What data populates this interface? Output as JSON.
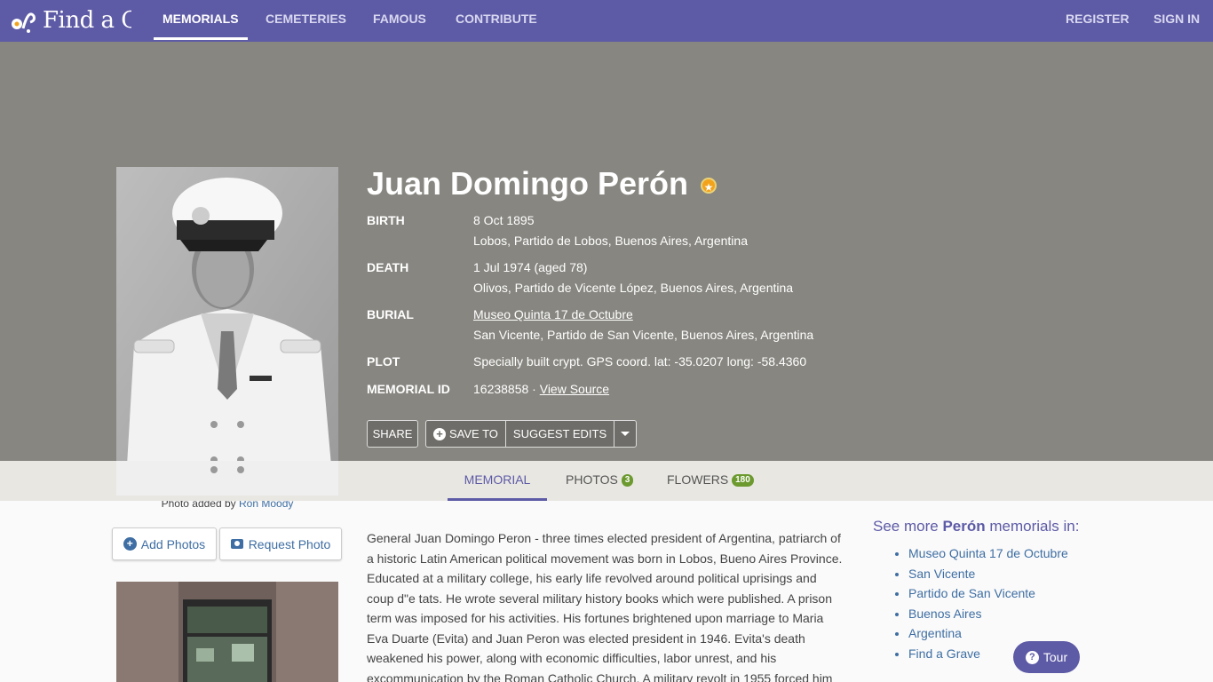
{
  "header": {
    "logo_text": "Find a Grave",
    "nav": [
      "MEMORIALS",
      "CEMETERIES",
      "FAMOUS",
      "CONTRIBUTE"
    ],
    "register": "REGISTER",
    "sign_in": "SIGN IN"
  },
  "memorial": {
    "name": "Juan Domingo Perón",
    "famous_badge_icon": "star-icon",
    "photo_caption_prefix": "Photo added by",
    "photo_added_by": "Ron Moody",
    "facts": {
      "birth_label": "BIRTH",
      "birth_date": "8 Oct 1895",
      "birth_place": "Lobos, Partido de Lobos, Buenos Aires, Argentina",
      "death_label": "DEATH",
      "death_date": "1 Jul 1974 (aged 78)",
      "death_place": "Olivos, Partido de Vicente López, Buenos Aires, Argentina",
      "burial_label": "BURIAL",
      "burial_cemetery": "Museo Quinta 17 de Octubre",
      "burial_place": "San Vicente, Partido de San Vicente, Buenos Aires, Argentina",
      "plot_label": "PLOT",
      "plot": "Specially built crypt. GPS coord. lat: -35.0207 long: -58.4360",
      "memorial_id_label": "MEMORIAL ID",
      "memorial_id": "16238858 ·",
      "view_source": "View Source"
    },
    "actions": {
      "share": "SHARE",
      "save_to": "SAVE TO",
      "suggest_edits": "SUGGEST EDITS"
    }
  },
  "tabs": {
    "memorial": "MEMORIAL",
    "photos": "PHOTOS",
    "photos_count": "3",
    "flowers": "FLOWERS",
    "flowers_count": "180"
  },
  "photo_actions": {
    "add_photos": "Add Photos",
    "request_photo": "Request Photo"
  },
  "bio": "General Juan Domingo Peron - three times elected president of Argentina, patriarch of a historic Latin American political movement was born in Lobos, Bueno Aires Province. Educated at a military college, his early life revolved around political uprisings and coup d\"e tats. He wrote several military history books which were published. A prison term was imposed for his activities. His fortunes brightened upon marriage to Maria Eva Duarte (Evita) and Juan Peron was elected president in 1946. Evita's death weakened his power, along with economic difficulties, labor unrest, and his excommunication by the Roman Catholic Church. A military revolt in 1955 forced him",
  "see_more": {
    "prefix": "See more",
    "surname": "Perón",
    "suffix": "memorials in:",
    "links": [
      "Museo Quinta 17 de Octubre",
      "San Vicente",
      "Partido de San Vicente",
      "Buenos Aires",
      "Argentina",
      "Find a Grave"
    ]
  },
  "tour_button": "Tour",
  "colors": {
    "brand": "#5d5aa6",
    "hero_bg": "#878680",
    "link": "#3e6ea3",
    "badge": "#6c9a2f",
    "star": "#f2a31b"
  }
}
